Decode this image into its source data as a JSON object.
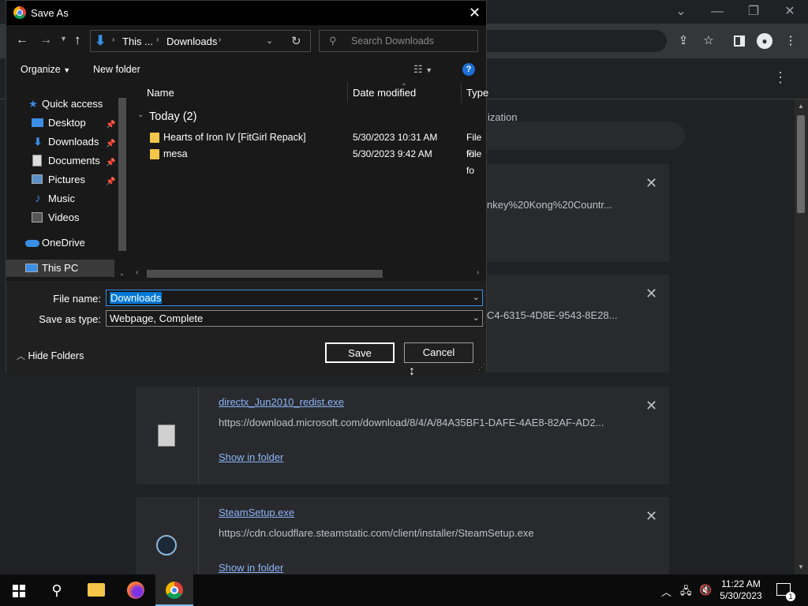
{
  "chrome": {
    "menu_icon": "more-vert-icon",
    "downloads_header_partial": "ization"
  },
  "downloads": [
    {
      "name": "",
      "url": "nkey%20Kong%20Countr..."
    },
    {
      "name": "",
      "url": "C4-6315-4D8E-9543-8E28..."
    },
    {
      "name": "directx_Jun2010_redist.exe",
      "url": "https://download.microsoft.com/download/8/4/A/84A35BF1-DAFE-4AE8-82AF-AD2...",
      "show": "Show in folder"
    },
    {
      "name": "SteamSetup.exe",
      "url": "https://cdn.cloudflare.steamstatic.com/client/installer/SteamSetup.exe",
      "show": "Show in folder"
    }
  ],
  "dialog": {
    "title": "Save As",
    "breadcrumb": [
      "This ...",
      "Downloads"
    ],
    "search_placeholder": "Search Downloads",
    "organize": "Organize",
    "new_folder": "New folder",
    "nav": [
      {
        "label": "Quick access",
        "icon": "star-icon"
      },
      {
        "label": "Desktop",
        "icon": "desktop-icon",
        "pinned": true
      },
      {
        "label": "Downloads",
        "icon": "download-icon",
        "pinned": true
      },
      {
        "label": "Documents",
        "icon": "documents-icon",
        "pinned": true
      },
      {
        "label": "Pictures",
        "icon": "pictures-icon",
        "pinned": true
      },
      {
        "label": "Music",
        "icon": "music-icon"
      },
      {
        "label": "Videos",
        "icon": "videos-icon"
      },
      {
        "label": "OneDrive",
        "icon": "cloud-icon"
      },
      {
        "label": "This PC",
        "icon": "computer-icon"
      }
    ],
    "columns": {
      "name": "Name",
      "date": "Date modified",
      "type": "Type"
    },
    "group": "Today (2)",
    "files": [
      {
        "name": "Hearts of Iron IV [FitGirl Repack]",
        "date": "5/30/2023 10:31 AM",
        "type": "File fo"
      },
      {
        "name": "mesa",
        "date": "5/30/2023 9:42 AM",
        "type": "File fo"
      }
    ],
    "file_name_label": "File name:",
    "file_name_value": "Downloads",
    "save_type_label": "Save as type:",
    "save_type_value": "Webpage, Complete",
    "hide_folders": "Hide Folders",
    "save": "Save",
    "cancel": "Cancel"
  },
  "taskbar": {
    "time": "11:22 AM",
    "date": "5/30/2023",
    "notification_count": "1"
  },
  "colors": {
    "accent": "#0078d7",
    "link": "#8ab4f8",
    "folder": "#f3c64a"
  }
}
